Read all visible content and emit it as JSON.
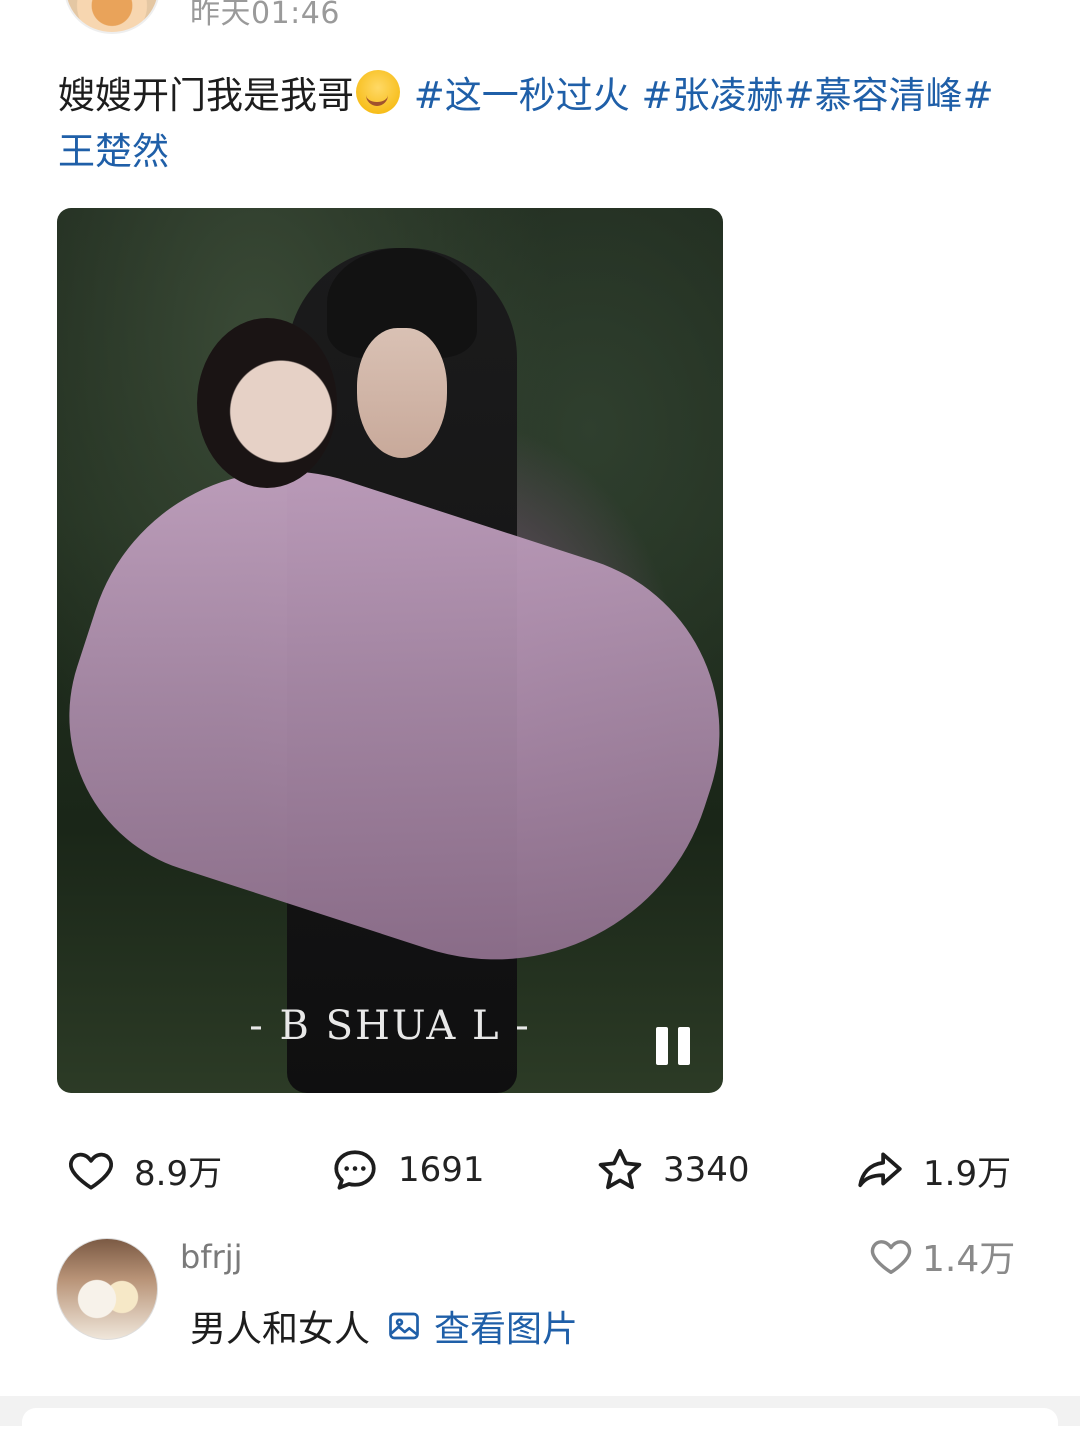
{
  "post": {
    "timestamp": "昨天01:46",
    "text_plain": "嫂嫂开门我是我哥",
    "emoji": "drooling-face",
    "tags": [
      "#这一秒过火",
      "#张凌赫",
      "#慕容清峰",
      "#王楚然"
    ]
  },
  "video": {
    "watermark": "- B SHUA L -",
    "state": "playing"
  },
  "actions": {
    "likes": "8.9万",
    "comments": "1691",
    "favorites": "3340",
    "shares": "1.9万"
  },
  "comment": {
    "username": "bfrjj",
    "text": "男人和女人",
    "link_label": "查看图片",
    "likes": "1.4万"
  },
  "icons": {
    "like": "heart-icon",
    "comment": "comment-bubble-icon",
    "favorite": "star-icon",
    "share": "share-arrow-icon",
    "image": "image-icon",
    "pause": "pause-icon"
  },
  "colors": {
    "tag": "#1f5fa8",
    "muted": "#9a9a9a",
    "text": "#1d1d1d"
  }
}
